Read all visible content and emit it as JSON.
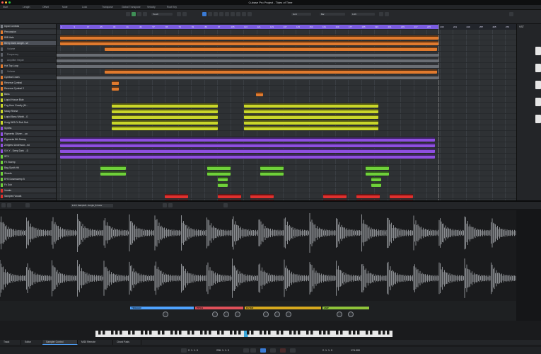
{
  "window": {
    "title": "Cubase Pro Project - Tides of Time"
  },
  "infoline": {
    "cols": [
      {
        "label": "Start",
        "value": "81. 1. 1. 0"
      },
      {
        "label": "Length",
        "value": "8. 0. 0. 0"
      },
      {
        "label": "Offset",
        "value": "0. 0. 0. 0"
      },
      {
        "label": "Mute",
        "value": ""
      },
      {
        "label": "Lock",
        "value": ""
      },
      {
        "label": "Transpose",
        "value": "0"
      },
      {
        "label": "Global Transpose",
        "value": "Follow"
      },
      {
        "label": "Velocity",
        "value": "0"
      },
      {
        "label": "Root Key",
        "value": "-"
      }
    ]
  },
  "toolbar": {
    "snap_mode": "Touch",
    "grid_type": "Grid",
    "grid_value": "Bar",
    "quantize": "1/16"
  },
  "tracks": [
    {
      "name": "Input Controls",
      "type": "folder",
      "color": "#7b7f86"
    },
    {
      "name": "Percussion",
      "type": "folder",
      "color": "#e07a2e"
    },
    {
      "name": "808 Hats",
      "type": "audio",
      "color": "#e07a2e"
    },
    {
      "name": "Bleep Dark Jungle...ve",
      "type": "audio",
      "color": "#e07a2e",
      "selected": true
    },
    {
      "name": "Volume",
      "type": "auto",
      "color": "#5d6168"
    },
    {
      "name": "Frequency",
      "type": "auto",
      "color": "#5d6168"
    },
    {
      "name": "Amplifier Heyde",
      "type": "auto",
      "color": "#5d6168"
    },
    {
      "name": "Hot Top Loop",
      "type": "audio",
      "color": "#e07a2e"
    },
    {
      "name": "Volume",
      "type": "auto",
      "color": "#5d6168"
    },
    {
      "name": "Cymbal Crash",
      "type": "audio",
      "color": "#e07a2e"
    },
    {
      "name": "Reverse Cymbal",
      "type": "audio",
      "color": "#e07a2e"
    },
    {
      "name": "Reverse Cymbal 2",
      "type": "audio",
      "color": "#e07a2e"
    },
    {
      "name": "Bass",
      "type": "folder",
      "color": "#c9d62a"
    },
    {
      "name": "Liquid House Blub",
      "type": "inst",
      "color": "#c9d62a"
    },
    {
      "name": "Fog Horn Gravity (M...",
      "type": "inst",
      "color": "#c9d62a"
    },
    {
      "name": "Nasty Reese",
      "type": "inst",
      "color": "#c9d62a"
    },
    {
      "name": "Liquid Bass Wobbl...G",
      "type": "inst",
      "color": "#c9d62a"
    },
    {
      "name": "Kroig 8KS-Dt Dub Sub",
      "type": "inst",
      "color": "#c9d62a"
    },
    {
      "name": "Synths",
      "type": "folder",
      "color": "#8e4fe0"
    },
    {
      "name": "Pigments Citizen ...ya",
      "type": "inst",
      "color": "#8e4fe0"
    },
    {
      "name": "Pigments 8th Sweep",
      "type": "inst",
      "color": "#8e4fe0"
    },
    {
      "name": "Zeitgeist Underscor...ed",
      "type": "inst",
      "color": "#8e4fe0"
    },
    {
      "name": "S.K.Y - Deep Dark ...D",
      "type": "inst",
      "color": "#8e4fe0"
    },
    {
      "name": "SFX",
      "type": "folder",
      "color": "#6fd13a"
    },
    {
      "name": "FX Sweep",
      "type": "audio",
      "color": "#6fd13a"
    },
    {
      "name": "Bag Synth Hit",
      "type": "audio",
      "color": "#6fd13a"
    },
    {
      "name": "Shards",
      "type": "audio",
      "color": "#6fd13a"
    },
    {
      "name": "B+B Downsweep 5",
      "type": "audio",
      "color": "#6fd13a"
    },
    {
      "name": "Fx Dub",
      "type": "audio",
      "color": "#6fd13a"
    },
    {
      "name": "Vocals",
      "type": "folder",
      "color": "#e0302e"
    },
    {
      "name": "Sampled Vocals",
      "type": "audio",
      "color": "#e0302e"
    }
  ],
  "ruler": {
    "bars": [
      "1",
      "9",
      "17",
      "25",
      "33",
      "41",
      "49",
      "57",
      "65",
      "73",
      "81",
      "89",
      "97",
      "105",
      "113",
      "121",
      "129",
      "137",
      "145",
      "153",
      "161",
      "169",
      "177",
      "185",
      "193",
      "201",
      "209",
      "217",
      "225",
      "233",
      "241",
      "249",
      "257",
      "265",
      "273"
    ]
  },
  "inspector": {
    "title": "VST"
  },
  "sampler": {
    "sample_name": "E.F.F Sample8...Jungle_84.wav",
    "sections": [
      {
        "label": "TRIGGER",
        "color": "#4fa3ff"
      },
      {
        "label": "PITCH",
        "color": "#e0505a"
      },
      {
        "label": "FILTER",
        "color": "#d6a91e"
      },
      {
        "label": "AMP",
        "color": "#8fc43a"
      }
    ],
    "knob_labels": [
      "GLIDE",
      "FINE",
      "COARSE",
      "CUTOFF",
      "RESO",
      "DRIVE",
      "VOLUME",
      "PAN",
      "ATTACK"
    ]
  },
  "tabs": [
    "Track",
    "Editor",
    "Sampler Control",
    "MIDI Remote",
    "Chord Pads"
  ],
  "transport": {
    "left_locator": "2. 1. 1. 0",
    "right_locator": "226. 1. 1. 0",
    "position": "2. 1. 1. 0",
    "tempo": "174.000"
  }
}
